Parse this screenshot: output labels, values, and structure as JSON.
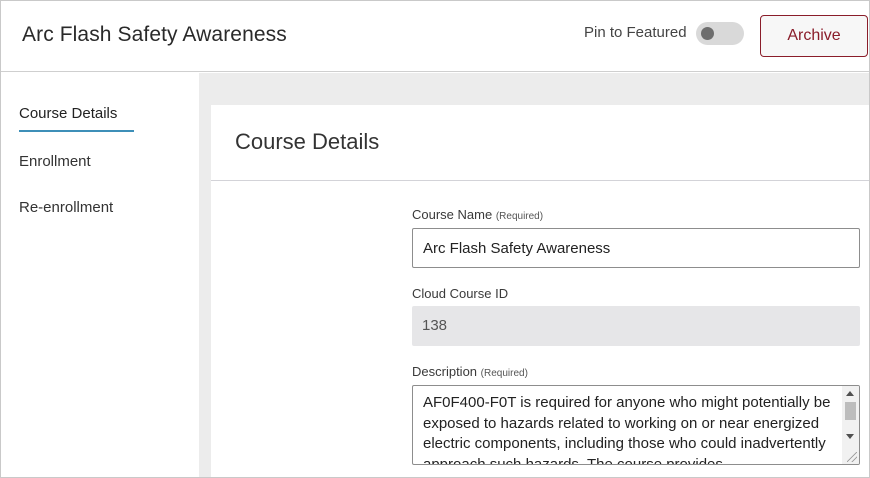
{
  "header": {
    "title": "Arc Flash Safety Awareness",
    "pin_label": "Pin to Featured",
    "pin_enabled": false,
    "archive_label": "Archive"
  },
  "sidebar": {
    "items": [
      {
        "label": "Course Details",
        "active": true
      },
      {
        "label": "Enrollment",
        "active": false
      },
      {
        "label": "Re-enrollment",
        "active": false
      }
    ]
  },
  "main": {
    "section_title": "Course Details",
    "fields": {
      "course_name": {
        "label": "Course Name",
        "required_note": "(Required)",
        "value": "Arc Flash Safety Awareness"
      },
      "cloud_course_id": {
        "label": "Cloud Course ID",
        "value": "138"
      },
      "description": {
        "label": "Description",
        "required_note": "(Required)",
        "value": "AF0F400-F0T is required for anyone who might potentially be exposed to hazards related to working on or near energized electric components, including those who could inadvertently approach such hazards. The course provides"
      }
    }
  },
  "colors": {
    "accent": "#3d8fb8",
    "archive": "#8a1d2a",
    "panel_bg": "#ececec"
  }
}
